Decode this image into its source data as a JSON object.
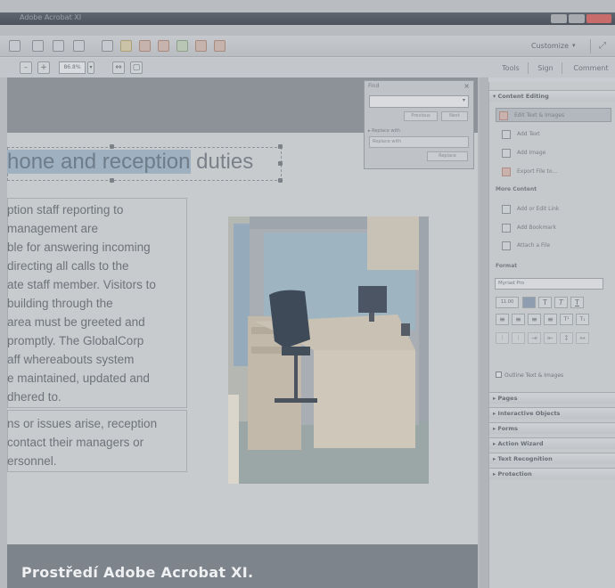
{
  "window": {
    "title": "Adobe Acrobat XI"
  },
  "toolbar": {
    "customize_label": "Customize",
    "customize_caret": "▾"
  },
  "toolbar2": {
    "zoom_value": "86.8%",
    "zoom_out": "–",
    "zoom_in": "+",
    "tabs": [
      "Tools",
      "Sign",
      "Comment"
    ]
  },
  "document": {
    "heading_pre": "hone and reception",
    "heading_post": " duties",
    "paragraph1": [
      "ption staff reporting to",
      " management are",
      "ble for answering incoming",
      " directing all calls to the",
      "ate staff member. Visitors to",
      " building through the",
      " area must be greeted and",
      " promptly. The GlobalCorp",
      "aff whereabouts system",
      "e maintained, updated and",
      "dhered to."
    ],
    "paragraph2": [
      "ns or issues arise, reception",
      " contact their managers or",
      "ersonnel."
    ]
  },
  "find_panel": {
    "title": "Find",
    "close": "×",
    "previous_label": "Previous",
    "next_label": "Next",
    "replace_label": "▸ Replace with",
    "replace_placeholder": "Replace with",
    "replace_button": "Replace"
  },
  "right_panel": {
    "content_editing_title": "▾ Content Editing",
    "tools": [
      "Edit Text & Images",
      "Add Text",
      "Add Image",
      "Export File to..."
    ],
    "more_content_title": "More Content",
    "more_tools": [
      "Add or Edit Link",
      "Add Bookmark",
      "Attach a File"
    ],
    "format_title": "Format",
    "font_value": "Myriad Pro",
    "font_size": "11.00",
    "outline_label": "Outline Text & Images",
    "sections": [
      "▸ Pages",
      "▸ Interactive Objects",
      "▸ Forms",
      "▸ Action Wizard",
      "▸ Text Recognition",
      "▸ Protection"
    ]
  },
  "caption": {
    "text": "Prostředí Adobe Acrobat XI."
  },
  "colors": {
    "highlight": "#9fb0c0",
    "caption_text": "#eef0f2",
    "footer_bar": "#7e848c"
  }
}
